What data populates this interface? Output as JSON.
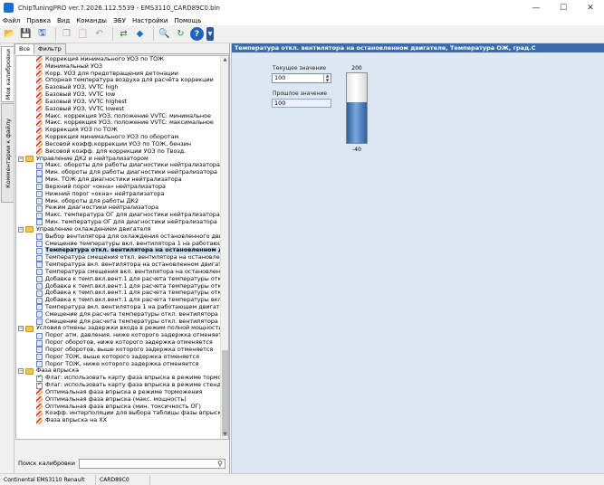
{
  "window": {
    "title": "ChipTuningPRO ver.7.2026.112.5539 - EMS3110_CARD89C0.bin"
  },
  "menu": [
    "Файл",
    "Правка",
    "Вид",
    "Команды",
    "ЭБУ",
    "Настройки",
    "Помощь"
  ],
  "side_tabs": {
    "calibrations": "Мои калибровки",
    "comments": "Комментарии к файлу"
  },
  "tree_tabs": {
    "all": "Все",
    "filter": "Фильтр"
  },
  "tree": [
    {
      "label": "Коррекция минимального УОЗ по ТОЖ",
      "icon": "curve",
      "level": 1
    },
    {
      "label": "Минимальный УОЗ",
      "icon": "curve",
      "level": 1
    },
    {
      "label": "Корр. УОЗ для предотвращения детонации",
      "icon": "curve",
      "level": 1
    },
    {
      "label": "Опорная температура воздуха для расчёта коррекции",
      "icon": "curve",
      "level": 1
    },
    {
      "label": "Базовый УОЗ, VVTC high",
      "icon": "curve",
      "level": 1
    },
    {
      "label": "Базовый УОЗ, VVTC low",
      "icon": "curve",
      "level": 1
    },
    {
      "label": "Базовый УОЗ, VVTC highest",
      "icon": "curve",
      "level": 1
    },
    {
      "label": "Базовый УОЗ, VVTC lowest",
      "icon": "curve",
      "level": 1
    },
    {
      "label": "Макс. коррекция УОЗ, положение VVTC: минимальное",
      "icon": "curve",
      "level": 1
    },
    {
      "label": "Макс. коррекция УОЗ, положение VVTC: максимальное",
      "icon": "curve",
      "level": 1
    },
    {
      "label": "Коррекция УОЗ по ТОЖ",
      "icon": "curve",
      "level": 1
    },
    {
      "label": "Коррекция минимального УОЗ по оборотам",
      "icon": "curve",
      "level": 1
    },
    {
      "label": "Весовой коэфф.коррекции УОЗ по ТОЖ, бензин",
      "icon": "curve",
      "level": 1
    },
    {
      "label": "Весовой коэфф. для коррекции УОЗ по Твозд.",
      "icon": "curve",
      "level": 1
    },
    {
      "label": "Управление ДК2 и нейтрализатором",
      "icon": "folder",
      "level": 0
    },
    {
      "label": "Макс. обороты для работы диагностики нейтрализатора",
      "icon": "table",
      "level": 1
    },
    {
      "label": "Мин. обороты для работы диагностики нейтрализатора",
      "icon": "table",
      "level": 1
    },
    {
      "label": "Мин. ТОЖ для диагностики нейтрализатора",
      "icon": "table",
      "level": 1
    },
    {
      "label": "Верхний порог «окна» нейтрализатора",
      "icon": "table",
      "level": 1
    },
    {
      "label": "Нижний порог «окна» нейтрализатора",
      "icon": "table",
      "level": 1
    },
    {
      "label": "Мин. обороты для работы ДК2",
      "icon": "table",
      "level": 1
    },
    {
      "label": "Режим диагностики нейтрализатора",
      "icon": "table",
      "level": 1
    },
    {
      "label": "Макс. температура ОГ для диагностики нейтрализатора",
      "icon": "table",
      "level": 1
    },
    {
      "label": "Мин. температура ОГ для диагностики нейтрализатора",
      "icon": "table",
      "level": 1
    },
    {
      "label": "Управление охлаждением двигателя",
      "icon": "folder",
      "level": 0
    },
    {
      "label": "Выбор вентилятора для охлаждения остановленного двигателя",
      "icon": "table",
      "level": 1
    },
    {
      "label": "Смещение температуры вкл. вентилятора 1 на работающем дв",
      "icon": "table",
      "level": 1
    },
    {
      "label": "Температура откл. вентилятора на остановленном двигателе",
      "icon": "table",
      "level": 1,
      "selected": true
    },
    {
      "label": "Температура смещения откл. вентилятора на остановленном",
      "icon": "table",
      "level": 1
    },
    {
      "label": "Температура вкл. вентилятора на остановленном двигателе",
      "icon": "table",
      "level": 1
    },
    {
      "label": "Температура смещения вкл. вентилятора на остановленном дв",
      "icon": "table",
      "level": 1
    },
    {
      "label": "Добавка к темп.вкл.вент.1 для расчета температуры откл.вент",
      "icon": "table",
      "level": 1
    },
    {
      "label": "Добавка к темп.вкл.вент.1 для расчета температуры откл.вент",
      "icon": "table",
      "level": 1
    },
    {
      "label": "Добавка к темп.вкл.вент.1 для расчета температуры откл.вент",
      "icon": "table",
      "level": 1
    },
    {
      "label": "Добавка к темп.вкл.вент.1 для расчета температуры вкл.вент.",
      "icon": "table",
      "level": 1
    },
    {
      "label": "Температура вкл. вентилятора 1 на работающем двигателе",
      "icon": "table",
      "level": 1
    },
    {
      "label": "Смещение для расчета температуры откл. вентилятора 1 на р",
      "icon": "table",
      "level": 1
    },
    {
      "label": "Смещение для расчета температуры откл. вентилятора 1 на р",
      "icon": "table",
      "level": 1
    },
    {
      "label": "Условия отмены задержки входа в режим полной мощности",
      "icon": "folder",
      "level": 0
    },
    {
      "label": "Порог атм. давления, ниже которого задержка отменяется",
      "icon": "table",
      "level": 1
    },
    {
      "label": "Порог оборотов, ниже которого задержка отменяется",
      "icon": "table",
      "level": 1
    },
    {
      "label": "Порог оборотов, выше которого задержка отменяется",
      "icon": "table",
      "level": 1
    },
    {
      "label": "Порог ТОЖ, выше которого задержка отменяется",
      "icon": "table",
      "level": 1
    },
    {
      "label": "Порог ТОЖ, ниже которого задержка отменяется",
      "icon": "table",
      "level": 1
    },
    {
      "label": "Фаза впрыска",
      "icon": "folder",
      "level": 0
    },
    {
      "label": "Флаг: использовать карту фаза впрыска в режиме торможения",
      "icon": "flag",
      "level": 1
    },
    {
      "label": "Флаг: использовать карту фаза впрыска в режиме стенд",
      "icon": "flag",
      "level": 1
    },
    {
      "label": "Оптимальная фаза впрыска в режиме торможения",
      "icon": "curve",
      "level": 1
    },
    {
      "label": "Оптимальная фаза впрыска (макс. мощность)",
      "icon": "curve",
      "level": 1
    },
    {
      "label": "Оптимальная фаза впрыска (мин. токсичность ОГ)",
      "icon": "curve",
      "level": 1
    },
    {
      "label": "Коэфф. интерполяции для выбора таблицы фазы впрыска",
      "icon": "curve",
      "level": 1
    },
    {
      "label": "Фаза впрыска на ХХ",
      "icon": "curve",
      "level": 1
    }
  ],
  "search": {
    "label": "Поиск калибровки",
    "value": ""
  },
  "editor": {
    "header": "Температура откл. вентилятора на остановленном двигателе, Температура ОЖ, град.С",
    "current_label": "Текущее значение",
    "current_value": "100",
    "previous_label": "Прошлое значение",
    "previous_value": "100",
    "gauge_max": "200",
    "gauge_min": "-40",
    "gauge_value": 100,
    "gauge_range": [
      -40,
      200
    ]
  },
  "status": {
    "ecu": "Continental EMS3110 Renault",
    "calibration": "CARD89C0"
  },
  "icons": {
    "toolbar": [
      "open-folder-icon",
      "save-icon",
      "save-as-icon",
      "copy-icon",
      "paste-icon",
      "undo-icon",
      "redo-icon",
      "compare-icon",
      "diamond-icon",
      "search-icon",
      "swap-icon",
      "help-icon",
      "dropdown-icon"
    ]
  },
  "colors": {
    "header": "#3b6ba8",
    "editor_bg": "#dde6f3",
    "gauge_fill": "#3a6cb0"
  }
}
